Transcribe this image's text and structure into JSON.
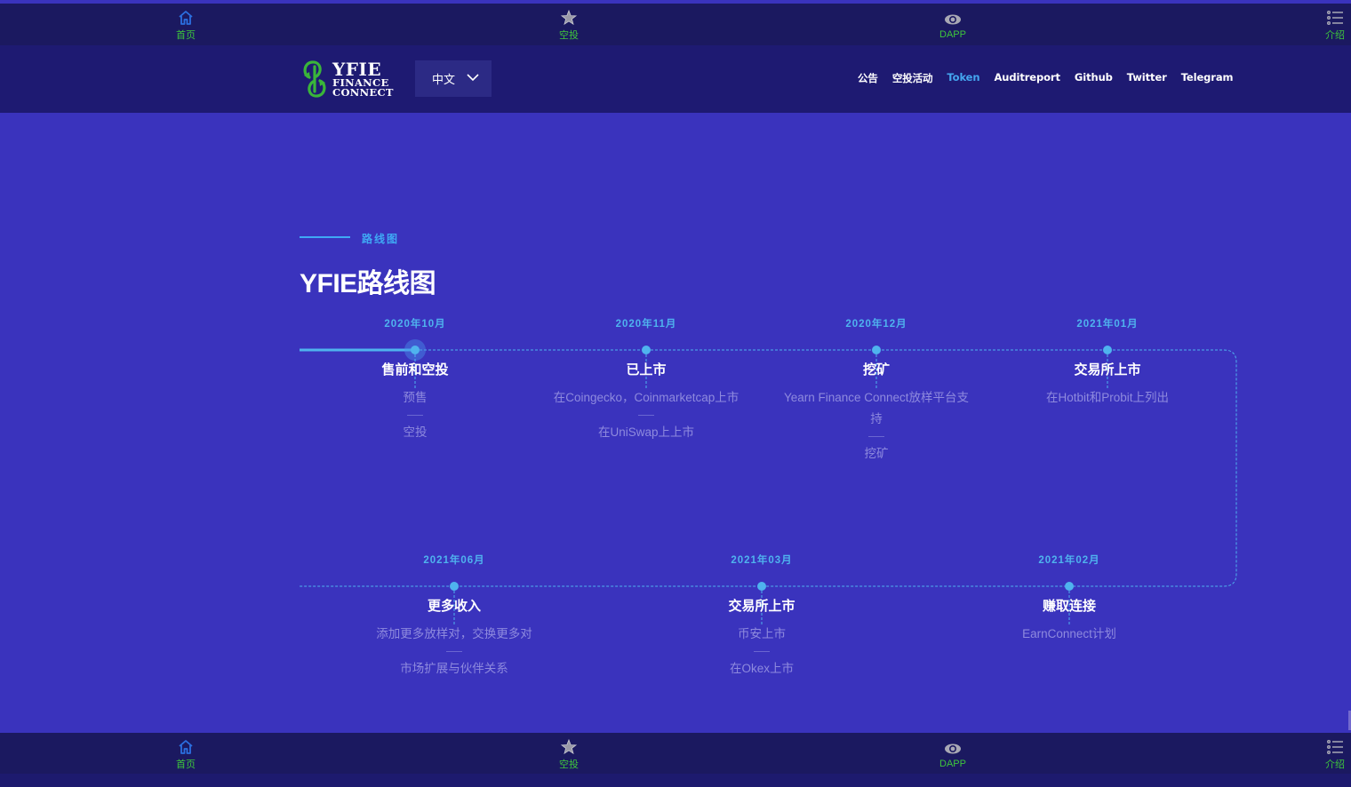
{
  "tabbar": {
    "items": [
      {
        "label": "首页",
        "icon": "home-icon"
      },
      {
        "label": "空投",
        "icon": "star-icon"
      },
      {
        "label": "DAPP",
        "icon": "eye-icon"
      },
      {
        "label": "介绍",
        "icon": "list-icon"
      }
    ]
  },
  "header": {
    "logo": {
      "line1": "YFIE",
      "line2": "FINANCE",
      "line3": "CONNECT"
    },
    "language": {
      "selected": "中文"
    },
    "menu": [
      {
        "label": "公告"
      },
      {
        "label": "空投活动"
      },
      {
        "label": "Token",
        "active": true
      },
      {
        "label": "Auditreport"
      },
      {
        "label": "Github"
      },
      {
        "label": "Twitter"
      },
      {
        "label": "Telegram"
      }
    ]
  },
  "section": {
    "eyebrow": "路线图",
    "title": "YFIE路线图"
  },
  "colors": {
    "background": "#3a33bd",
    "nav": "#1e1a72",
    "tabbar": "#1b1960",
    "accent": "#4fb3ee",
    "tab_label": "#3ec63c"
  },
  "roadmap": {
    "progress_completed_milestones": 1,
    "milestones": [
      {
        "date": "2020年10月",
        "title": "售前和空投",
        "items": [
          "预售",
          "空投"
        ]
      },
      {
        "date": "2020年11月",
        "title": "已上市",
        "items": [
          "在Coingecko，Coinmarketcap上市",
          "在UniSwap上上市"
        ]
      },
      {
        "date": "2020年12月",
        "title": "挖矿",
        "items": [
          "Yearn Finance Connect放样平台支持",
          "挖矿"
        ]
      },
      {
        "date": "2021年01月",
        "title": "交易所上市",
        "items": [
          "在Hotbit和Probit上列出"
        ]
      },
      {
        "date": "2021年02月",
        "title": "赚取连接",
        "items": [
          "EarnConnect计划"
        ]
      },
      {
        "date": "2021年03月",
        "title": "交易所上市",
        "items": [
          "币安上市",
          "在Okex上市"
        ]
      },
      {
        "date": "2021年06月",
        "title": "更多收入",
        "items": [
          "添加更多放样对，交换更多对",
          "市场扩展与伙伴关系"
        ]
      }
    ]
  }
}
